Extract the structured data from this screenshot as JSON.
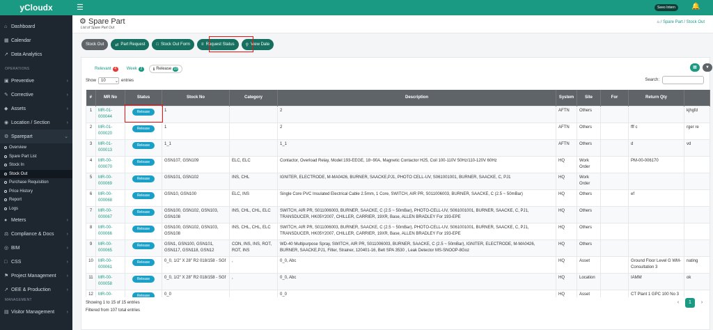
{
  "app": {
    "brand": "yCloudx",
    "user": "Seeo Intern"
  },
  "sidebar": {
    "top": [
      {
        "icon": "⌂",
        "label": "Dashboard"
      },
      {
        "icon": "▦",
        "label": "Calendar"
      },
      {
        "icon": "↗",
        "label": "Data Analytics"
      }
    ],
    "operations_label": "OPERATIONS",
    "ops": [
      {
        "icon": "▣",
        "label": "Preventive"
      },
      {
        "icon": "✎",
        "label": "Corrective"
      },
      {
        "icon": "◆",
        "label": "Assets"
      },
      {
        "icon": "◉",
        "label": "Location / Section"
      },
      {
        "icon": "⚙",
        "label": "Sparepart"
      }
    ],
    "subitems": [
      "Overview",
      "Spare Part List",
      "Stock In",
      "Stock Out",
      "Purchase Requisition",
      "Price History",
      "Report",
      "Logs"
    ],
    "more": [
      {
        "icon": "●",
        "label": "Meters"
      },
      {
        "icon": "⚖",
        "label": "Compliance & Docs"
      },
      {
        "icon": "◎",
        "label": "BIM"
      },
      {
        "icon": "□",
        "label": "CSS"
      },
      {
        "icon": "⚑",
        "label": "Project Management"
      },
      {
        "icon": "↗",
        "label": "OEE & Production"
      }
    ],
    "management_label": "MANAGEMENT",
    "mgmt": [
      {
        "icon": "▤",
        "label": "Visitor Management"
      }
    ]
  },
  "header": {
    "title": "Spare Part",
    "subtitle": "List of Spare Part Out",
    "breadcrumb": [
      "Spare Part",
      "Stock Out"
    ]
  },
  "buttons": [
    "Stock Out",
    "Part Request",
    "Stock Out Form",
    "Request Status",
    "View Date"
  ],
  "tabs": [
    {
      "label": "Relevant",
      "count": "4",
      "color": "#e53935"
    },
    {
      "label": "Week",
      "count": "2",
      "color": "#1a9a82"
    },
    {
      "label": "Release",
      "count": "15",
      "color": "#1a9a82"
    }
  ],
  "table": {
    "show_label": "Show",
    "show_value": "10",
    "entries_label": "entries",
    "search_label": "Search:",
    "headers": [
      "#",
      "MR No",
      "Status",
      "Stock No",
      "Category",
      "Description",
      "System",
      "Site",
      "For",
      "Return Qty",
      ""
    ],
    "rows": [
      [
        "1",
        "MR-01-000044",
        "Release",
        "1",
        "",
        "2",
        "AFTN",
        "Others",
        "",
        "",
        "kjhgfd"
      ],
      [
        "2",
        "MR-01-000020",
        "Release",
        "1",
        "",
        "2",
        "AFTN",
        "Others",
        "",
        "fff c",
        "rger re"
      ],
      [
        "3",
        "MR-01-000013",
        "Release",
        "1_1",
        "",
        "1_1",
        "AFTN",
        "Others",
        "",
        "d",
        "vd"
      ],
      [
        "4",
        "MR-00-000070",
        "Release",
        "GSN107, GSN109",
        "ELC, ELC",
        "Contactor, Overload Relay, Model:193-EEGE, 18~90A, Magnetic Contactor H25, Coil 100-110V 50Hz/110-120V 60Hz",
        "HQ",
        "Work Order",
        "",
        "PM-00-006170",
        ""
      ],
      [
        "5",
        "MR-00-000069",
        "Release",
        "GSN101, GSN102",
        "INS, CHL",
        "IGNITER, ELECTRODE, M-MA0426, BURNER, SAACKE,PJ1, PHOTO CELL-UV, S061001001, BURNER, SAACKE, C, PJ1",
        "HQ",
        "Work Order",
        "",
        "",
        ""
      ],
      [
        "6",
        "MR-00-000068",
        "Release",
        "GSN10, GSN100",
        "ELC, INS",
        "Single Core PVC Insulated Electrical Cable 2.5mm, 1 Core, SWITCH, AIR PR, S011006003, BURNER, SAACKE, C (2.5 ~ 50mBar)",
        "HQ",
        "Others",
        "",
        "ef",
        ""
      ],
      [
        "7",
        "MR-00-000067",
        "Release",
        "GSN100, GSN102, GSN103, GSN108",
        "INS, CHL, CHL, ELC",
        "SWITCH, AIR PR, S011006003, BURNER, SAACKE, C (2.5 ~ 50mBar), PHOTO-CELL-UV, S061001001, BURNER, SAACKE, C, PJ1, TRANSDUCER, HK05Y2007, CHILLER, CARRIER, 19XR, Base, ALLEN BRADLEY For 193-EPE",
        "HQ",
        "Others",
        "",
        "",
        ""
      ],
      [
        "8",
        "MR-00-000066",
        "Release",
        "GSN100, GSN102, GSN103, GSN108",
        "INS, CHL, CHL, ELC",
        "SWITCH, AIR PR, S011006003, BURNER, SAACKE, C (2.5 ~ 50mBar), PHOTO-CELL-UV, S061001001, BURNER, SAACKE, C, PJ1, TRANSDUCER, HK05Y2007, CHILLER, CARRIER, 19XR, Base, ALLEN BRADLEY For 193-EPE",
        "HQ",
        "Others",
        "",
        "",
        ""
      ],
      [
        "9",
        "MR-00-000065",
        "Release",
        "GSN1, GSN100, GSN101, GSN117, GSN118, GSN12",
        "CON, INS, INS, ROT, ROT, INS",
        "WD-40 Multipurpose Spray, SWITCH, AIR PR, S011006003, BURNER, SAACKE, C (2.5 ~ 50mBar), IGNITER, ELECTRODE, M-MA0426, BURNER, SAACKE,PJ1, Filter, Strainer, 120401-16, Belt SPA 3530 , Leak Detector MS-SNOOP-8Goz",
        "HQ",
        "Others",
        "",
        "",
        ""
      ],
      [
        "10",
        "MR-00-000061",
        "Release",
        "0_0, 1/2\" X 28\" R2 018/158 - SGf",
        ",",
        "0_0, Abc",
        "HQ",
        "Asset",
        "",
        "Ground Floor Level G WM-Consultation 3",
        "nating"
      ],
      [
        "11",
        "MR-00-000058",
        "Release",
        "0_0, 1/2\" X 28\" R2 018/158 - SGf",
        ",",
        "0_0, Abc",
        "HQ",
        "Location",
        "",
        "IAMM",
        "ok"
      ],
      [
        "12",
        "MR-00-",
        "Release",
        "0_0",
        "",
        "0_0",
        "HQ",
        "Asset",
        "",
        "CT Plant 1 GPC 100 No 3",
        ""
      ]
    ],
    "showing": "Showing 1 to 15 of 15 entries",
    "filtered": "Filtered from 107 total entries",
    "page": "1"
  }
}
